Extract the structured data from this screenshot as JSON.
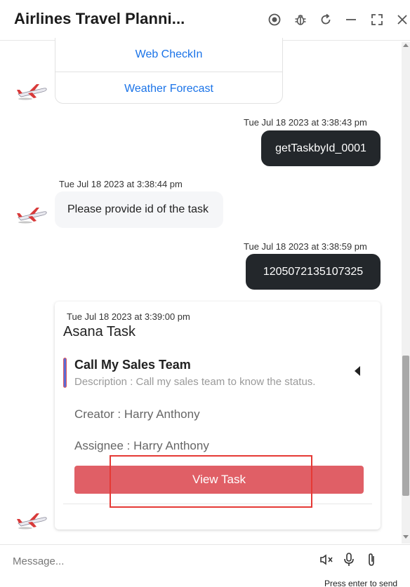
{
  "header": {
    "title": "Airlines Travel Planni...",
    "icons": [
      "record-icon",
      "bug-icon",
      "refresh-icon",
      "minimize-icon",
      "fullscreen-icon",
      "close-icon"
    ]
  },
  "quick_replies": {
    "items": [
      {
        "label": "Web CheckIn"
      },
      {
        "label": "Weather Forecast"
      }
    ]
  },
  "messages": [
    {
      "sender": "user",
      "timestamp": "Tue Jul 18 2023 at 3:38:43 pm",
      "text": "getTaskbyId_0001"
    },
    {
      "sender": "bot",
      "timestamp": "Tue Jul 18 2023 at 3:38:44 pm",
      "text": "Please provide id of the task"
    },
    {
      "sender": "user",
      "timestamp": "Tue Jul 18 2023 at 3:38:59 pm",
      "text": "1205072135107325"
    }
  ],
  "asana_card": {
    "timestamp": "Tue Jul 18 2023 at 3:39:00 pm",
    "title": "Asana Task",
    "task_name": "Call My Sales Team",
    "description": "Description : Call my sales team to know the status.",
    "creator": "Creator : Harry Anthony",
    "assignee": "Assignee : Harry Anthony",
    "button_label": "View Task",
    "button_color": "#e05f66"
  },
  "composer": {
    "placeholder": "Message...",
    "hint": "Press enter to send",
    "icons": [
      "mute-icon",
      "microphone-icon",
      "attachment-icon"
    ]
  },
  "colors": {
    "user_bubble": "#23272b",
    "link": "#1a73e8",
    "highlight": "#e53935"
  }
}
